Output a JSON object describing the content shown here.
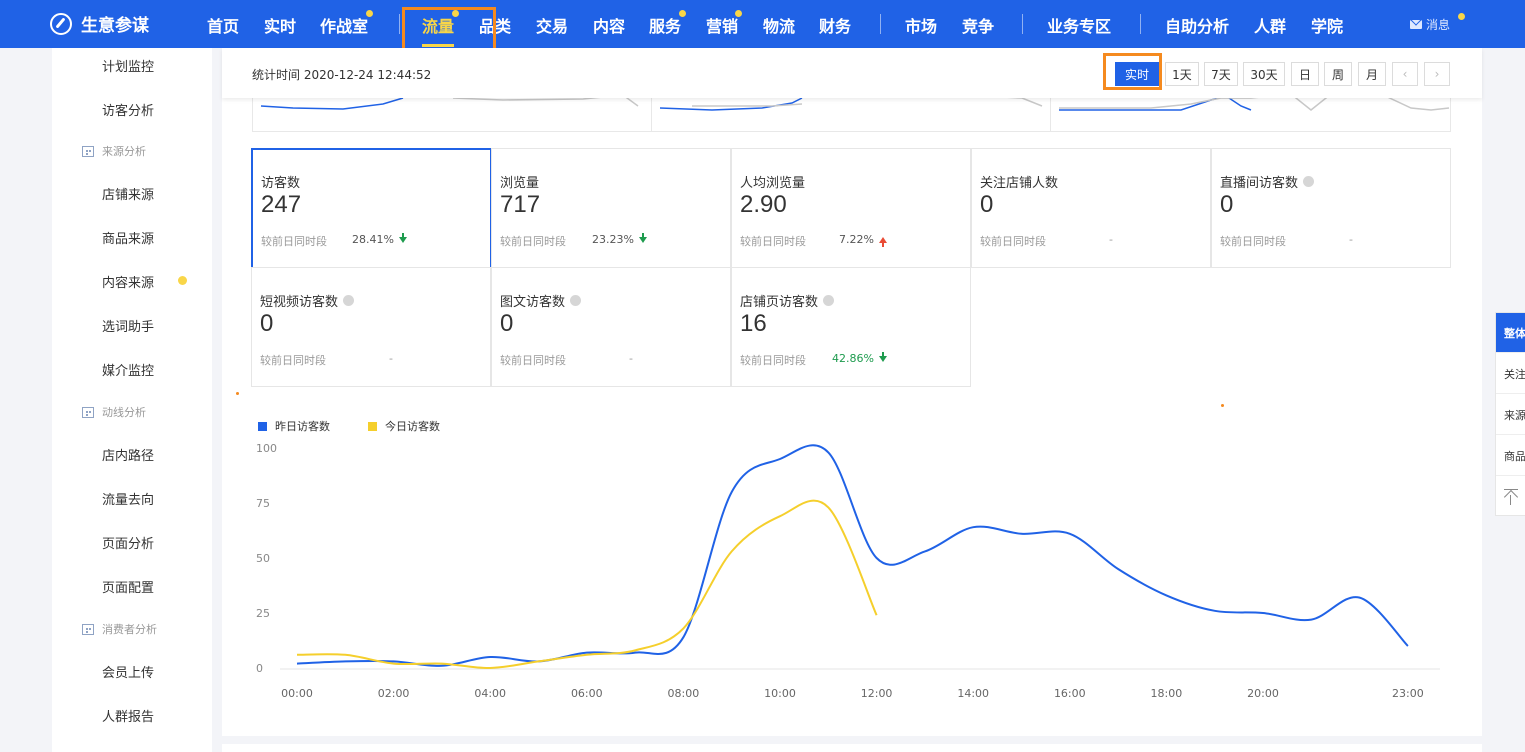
{
  "brand": {
    "name": "生意参谋"
  },
  "nav": {
    "items": [
      {
        "label": "首页"
      },
      {
        "label": "实时"
      },
      {
        "label": "作战室"
      },
      {
        "label": "流量"
      },
      {
        "label": "品类"
      },
      {
        "label": "交易"
      },
      {
        "label": "内容"
      },
      {
        "label": "服务"
      },
      {
        "label": "营销"
      },
      {
        "label": "物流"
      },
      {
        "label": "财务"
      },
      {
        "label": "市场"
      },
      {
        "label": "竞争"
      },
      {
        "label": "业务专区"
      },
      {
        "label": "自助分析"
      },
      {
        "label": "人群"
      },
      {
        "label": "学院"
      }
    ],
    "active": "流量",
    "message": "消息"
  },
  "sidebar": {
    "items": {
      "plan": "计划监控",
      "visitor": "访客分析",
      "grp_source": "来源分析",
      "shop_source": "店铺来源",
      "goods_source": "商品来源",
      "content_source": "内容来源",
      "keyword": "选词助手",
      "media": "媒介监控",
      "grp_flow": "动线分析",
      "path": "店内路径",
      "destination": "流量去向",
      "page_analysis": "页面分析",
      "page_config": "页面配置",
      "grp_consumer": "消费者分析",
      "member": "会员上传",
      "crowd": "人群报告"
    }
  },
  "statbar": {
    "time_text": "统计时间 2020-12-24 12:44:52",
    "buttons": [
      "实时",
      "1天",
      "7天",
      "30天",
      "日",
      "周",
      "月"
    ],
    "active": "实时"
  },
  "metrics": [
    {
      "label": "访客数",
      "value": "247",
      "compare": "较前日同时段",
      "pct": "28.41%",
      "trend": "down"
    },
    {
      "label": "浏览量",
      "value": "717",
      "compare": "较前日同时段",
      "pct": "23.23%",
      "trend": "down"
    },
    {
      "label": "人均浏览量",
      "value": "2.90",
      "compare": "较前日同时段",
      "pct": "7.22%",
      "trend": "up"
    },
    {
      "label": "关注店铺人数",
      "value": "0",
      "compare": "较前日同时段",
      "pct": "-",
      "trend": "none"
    },
    {
      "label": "直播间访客数",
      "value": "0",
      "compare": "较前日同时段",
      "pct": "-",
      "trend": "none"
    },
    {
      "label": "短视频访客数",
      "value": "0",
      "compare": "较前日同时段",
      "pct": "-",
      "trend": "none"
    },
    {
      "label": "图文访客数",
      "value": "0",
      "compare": "较前日同时段",
      "pct": "-",
      "trend": "none"
    },
    {
      "label": "店铺页访客数",
      "value": "16",
      "compare": "较前日同时段",
      "pct": "42.86%",
      "trend": "down"
    }
  ],
  "right_float": {
    "items": [
      "整体",
      "关注",
      "来源",
      "商品"
    ]
  },
  "colors": {
    "primary": "#2062e6",
    "accent_yellow": "#f9d648",
    "highlight_orange": "#f58a1f",
    "trend_down": "#1e9b4e",
    "trend_up": "#e94b35"
  },
  "chart_data": {
    "type": "line",
    "x_ticks": [
      "00:00",
      "02:00",
      "04:00",
      "06:00",
      "08:00",
      "10:00",
      "12:00",
      "14:00",
      "16:00",
      "18:00",
      "20:00",
      "23:00"
    ],
    "y_ticks": [
      "100",
      "75",
      "50",
      "25",
      "0"
    ],
    "ylim": [
      0,
      100
    ],
    "series": [
      {
        "name": "昨日访客数",
        "color": "#2062e6",
        "values": [
          2,
          3,
          3,
          1,
          5,
          3,
          7,
          7,
          14,
          80,
          95,
          98,
          50,
          53,
          64,
          61,
          61,
          45,
          33,
          26,
          25,
          22,
          32,
          10
        ]
      },
      {
        "name": "今日访客数",
        "color": "#f5cf2c",
        "values": [
          6,
          6,
          2,
          2,
          0,
          3,
          6,
          8,
          18,
          53,
          69,
          73,
          24
        ]
      }
    ]
  }
}
